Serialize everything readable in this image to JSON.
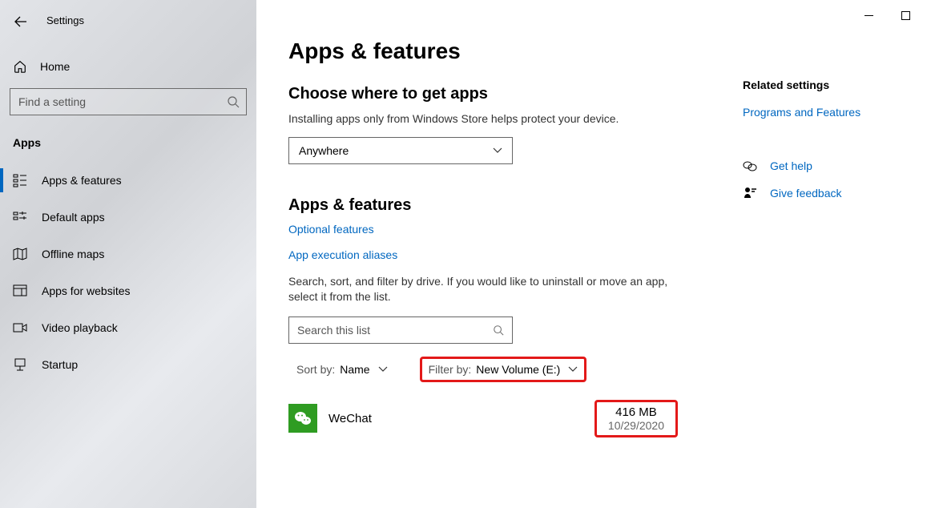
{
  "window": {
    "title": "Settings"
  },
  "sidebar": {
    "home": "Home",
    "search_placeholder": "Find a setting",
    "category": "Apps",
    "items": [
      {
        "label": "Apps & features"
      },
      {
        "label": "Default apps"
      },
      {
        "label": "Offline maps"
      },
      {
        "label": "Apps for websites"
      },
      {
        "label": "Video playback"
      },
      {
        "label": "Startup"
      }
    ]
  },
  "page": {
    "title": "Apps & features",
    "section1": {
      "heading": "Choose where to get apps",
      "desc": "Installing apps only from Windows Store helps protect your device.",
      "combo": "Anywhere"
    },
    "section2": {
      "heading": "Apps & features",
      "link_optional": "Optional features",
      "link_aliases": "App execution aliases",
      "desc": "Search, sort, and filter by drive. If you would like to uninstall or move an app, select it from the list.",
      "search_placeholder": "Search this list",
      "sort": {
        "label": "Sort by:",
        "value": "Name"
      },
      "filter": {
        "label": "Filter by:",
        "value": "New Volume (E:)"
      },
      "apps": [
        {
          "name": "WeChat",
          "size": "416 MB",
          "date": "10/29/2020"
        }
      ]
    }
  },
  "right": {
    "heading": "Related settings",
    "link": "Programs and Features",
    "help": "Get help",
    "feedback": "Give feedback"
  }
}
